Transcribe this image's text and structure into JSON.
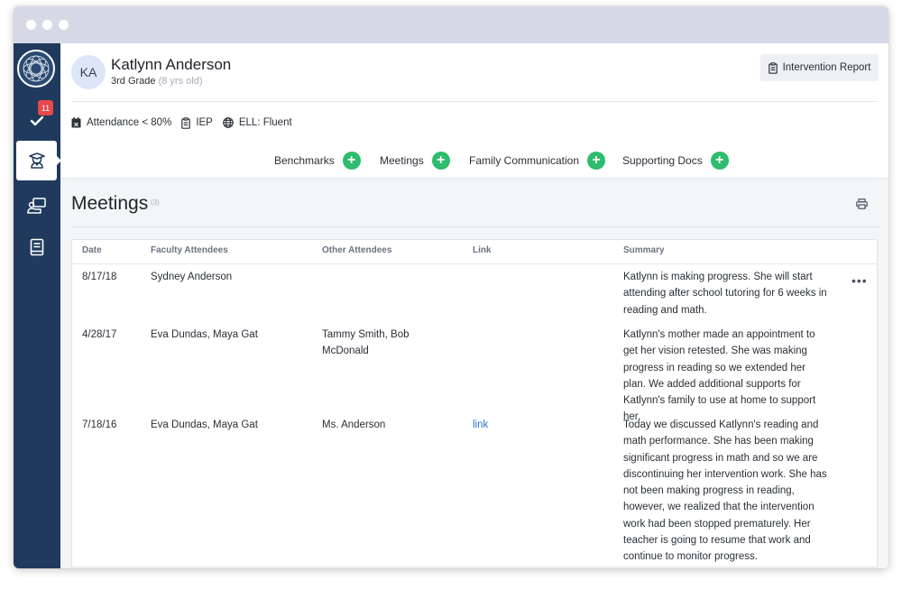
{
  "student": {
    "initials": "KA",
    "name": "Katlynn Anderson",
    "grade": "3rd Grade",
    "age": "(8 yrs old)"
  },
  "header": {
    "report_button": "Intervention Report"
  },
  "sidebar": {
    "notification_count": "11"
  },
  "tags": [
    "Attendance < 80%",
    "IEP",
    "ELL: Fluent"
  ],
  "tabs": [
    {
      "label": "Benchmarks"
    },
    {
      "label": "Meetings"
    },
    {
      "label": "Family Communication"
    },
    {
      "label": "Supporting Docs"
    }
  ],
  "plus_symbol": "+",
  "meetings": {
    "title": "Meetings",
    "count": "(3)",
    "columns": [
      "Date",
      "Faculty Attendees",
      "Other Attendees",
      "Link",
      "Summary"
    ],
    "more_symbol": "•••",
    "rows": [
      {
        "date": "8/17/18",
        "faculty": "Sydney Anderson",
        "other": "",
        "link": "",
        "summary": "Katlynn is making progress. She will start attending after school tutoring for 6 weeks in reading and math."
      },
      {
        "date": "4/28/17",
        "faculty": "Eva Dundas, Maya Gat",
        "other": "Tammy Smith, Bob McDonald",
        "link": "",
        "summary": "Katlynn's mother made an appointment to get her vision retested. She was making progress in reading so we extended her plan. We added additional supports for Katlynn's family to use at home to support her."
      },
      {
        "date": "7/18/16",
        "faculty": "Eva Dundas, Maya Gat",
        "other": "Ms. Anderson",
        "link": "link",
        "summary": "Today we discussed Katlynn's reading and math performance. She has been making significant progress in math and so we are discontinuing her intervention work. She has not been making progress in reading, however, we realized that the intervention work had been stopped prematurely. Her teacher is going to resume that work and continue to monitor progress."
      }
    ]
  },
  "colors": {
    "sidebar": "#1f3a5c",
    "accent_green": "#2ebc6d",
    "badge_red": "#e8474b",
    "link_blue": "#2b6fd1"
  }
}
